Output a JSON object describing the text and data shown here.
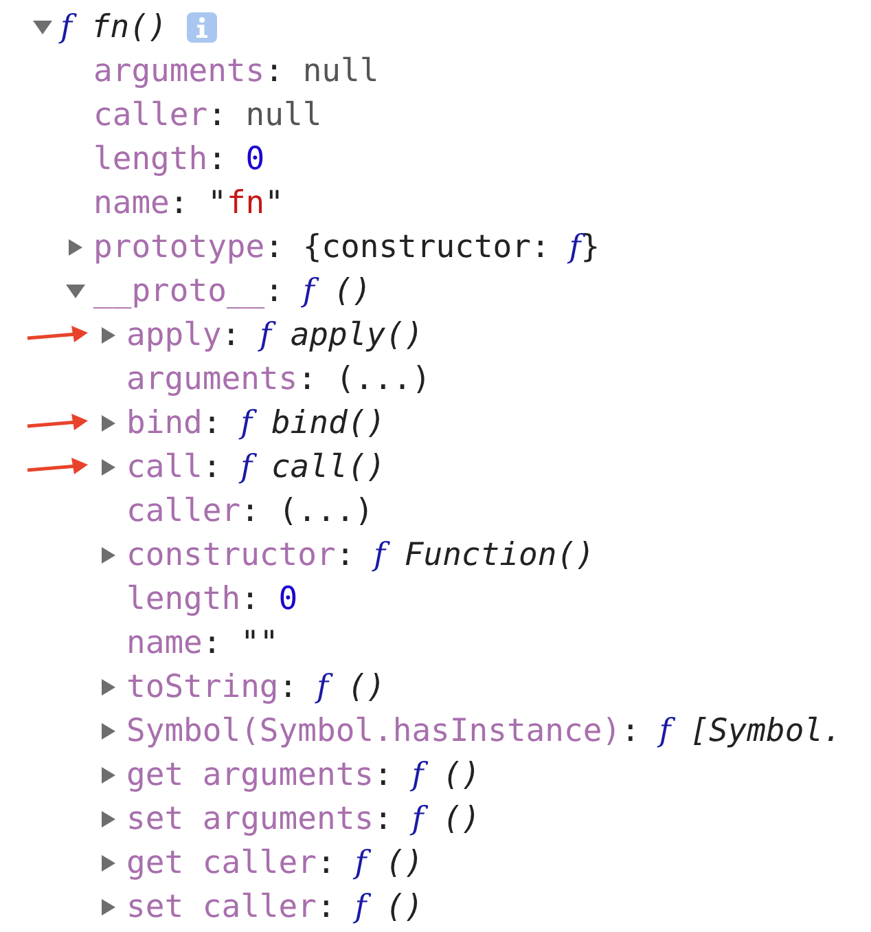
{
  "tree": {
    "kind": "branch",
    "expanded": true,
    "info": true,
    "parts": [
      {
        "kind": "sign",
        "text": "f"
      },
      {
        "kind": "italic",
        "text": " fn()"
      }
    ],
    "children": [
      {
        "kind": "leaf",
        "parts": [
          {
            "kind": "key",
            "text": "arguments"
          },
          {
            "kind": "punct",
            "text": ": "
          },
          {
            "kind": "null",
            "text": "null"
          }
        ]
      },
      {
        "kind": "leaf",
        "parts": [
          {
            "kind": "key",
            "text": "caller"
          },
          {
            "kind": "punct",
            "text": ": "
          },
          {
            "kind": "null",
            "text": "null"
          }
        ]
      },
      {
        "kind": "leaf",
        "parts": [
          {
            "kind": "key",
            "text": "length"
          },
          {
            "kind": "punct",
            "text": ": "
          },
          {
            "kind": "number",
            "text": "0"
          }
        ]
      },
      {
        "kind": "leaf",
        "parts": [
          {
            "kind": "key",
            "text": "name"
          },
          {
            "kind": "punct",
            "text": ": \""
          },
          {
            "kind": "string",
            "text": "fn"
          },
          {
            "kind": "punct",
            "text": "\""
          }
        ]
      },
      {
        "kind": "branch",
        "expanded": false,
        "parts": [
          {
            "kind": "key",
            "text": "prototype"
          },
          {
            "kind": "punct",
            "text": ": {constructor: "
          },
          {
            "kind": "sign",
            "text": "f"
          },
          {
            "kind": "punct",
            "text": "}"
          }
        ]
      },
      {
        "kind": "branch",
        "expanded": true,
        "parts": [
          {
            "kind": "key",
            "text": "__proto__"
          },
          {
            "kind": "punct",
            "text": ": "
          },
          {
            "kind": "sign",
            "text": "f"
          },
          {
            "kind": "italic",
            "text": " ()"
          }
        ],
        "children": [
          {
            "kind": "branch",
            "expanded": false,
            "pointer": true,
            "parts": [
              {
                "kind": "key",
                "text": "apply"
              },
              {
                "kind": "punct",
                "text": ": "
              },
              {
                "kind": "sign",
                "text": "f"
              },
              {
                "kind": "italic",
                "text": " apply()"
              }
            ]
          },
          {
            "kind": "leaf",
            "parts": [
              {
                "kind": "key",
                "text": "arguments"
              },
              {
                "kind": "punct",
                "text": ": (...)"
              }
            ]
          },
          {
            "kind": "branch",
            "expanded": false,
            "pointer": true,
            "parts": [
              {
                "kind": "key",
                "text": "bind"
              },
              {
                "kind": "punct",
                "text": ": "
              },
              {
                "kind": "sign",
                "text": "f"
              },
              {
                "kind": "italic",
                "text": " bind()"
              }
            ]
          },
          {
            "kind": "branch",
            "expanded": false,
            "pointer": true,
            "parts": [
              {
                "kind": "key",
                "text": "call"
              },
              {
                "kind": "punct",
                "text": ": "
              },
              {
                "kind": "sign",
                "text": "f"
              },
              {
                "kind": "italic",
                "text": " call()"
              }
            ]
          },
          {
            "kind": "leaf",
            "parts": [
              {
                "kind": "key",
                "text": "caller"
              },
              {
                "kind": "punct",
                "text": ": (...)"
              }
            ]
          },
          {
            "kind": "branch",
            "expanded": false,
            "parts": [
              {
                "kind": "key",
                "text": "constructor"
              },
              {
                "kind": "punct",
                "text": ": "
              },
              {
                "kind": "sign",
                "text": "f"
              },
              {
                "kind": "italic",
                "text": " Function()"
              }
            ]
          },
          {
            "kind": "leaf",
            "parts": [
              {
                "kind": "key",
                "text": "length"
              },
              {
                "kind": "punct",
                "text": ": "
              },
              {
                "kind": "number",
                "text": "0"
              }
            ]
          },
          {
            "kind": "leaf",
            "parts": [
              {
                "kind": "key",
                "text": "name"
              },
              {
                "kind": "punct",
                "text": ": \"\""
              }
            ]
          },
          {
            "kind": "branch",
            "expanded": false,
            "parts": [
              {
                "kind": "key",
                "text": "toString"
              },
              {
                "kind": "punct",
                "text": ": "
              },
              {
                "kind": "sign",
                "text": "f"
              },
              {
                "kind": "italic",
                "text": " ()"
              }
            ]
          },
          {
            "kind": "branch",
            "expanded": false,
            "parts": [
              {
                "kind": "key",
                "text": "Symbol(Symbol.hasInstance)"
              },
              {
                "kind": "punct",
                "text": ": "
              },
              {
                "kind": "sign",
                "text": "f"
              },
              {
                "kind": "italic",
                "text": " [Symbol."
              }
            ]
          },
          {
            "kind": "branch",
            "expanded": false,
            "parts": [
              {
                "kind": "key",
                "text": "get arguments"
              },
              {
                "kind": "punct",
                "text": ": "
              },
              {
                "kind": "sign",
                "text": "f"
              },
              {
                "kind": "italic",
                "text": " ()"
              }
            ]
          },
          {
            "kind": "branch",
            "expanded": false,
            "parts": [
              {
                "kind": "key",
                "text": "set arguments"
              },
              {
                "kind": "punct",
                "text": ": "
              },
              {
                "kind": "sign",
                "text": "f"
              },
              {
                "kind": "italic",
                "text": " ()"
              }
            ]
          },
          {
            "kind": "branch",
            "expanded": false,
            "parts": [
              {
                "kind": "key",
                "text": "get caller"
              },
              {
                "kind": "punct",
                "text": ": "
              },
              {
                "kind": "sign",
                "text": "f"
              },
              {
                "kind": "italic",
                "text": " ()"
              }
            ]
          },
          {
            "kind": "branch",
            "expanded": false,
            "parts": [
              {
                "kind": "key",
                "text": "set caller"
              },
              {
                "kind": "punct",
                "text": ": "
              },
              {
                "kind": "sign",
                "text": "f"
              },
              {
                "kind": "italic",
                "text": " ()"
              }
            ]
          }
        ]
      }
    ]
  }
}
